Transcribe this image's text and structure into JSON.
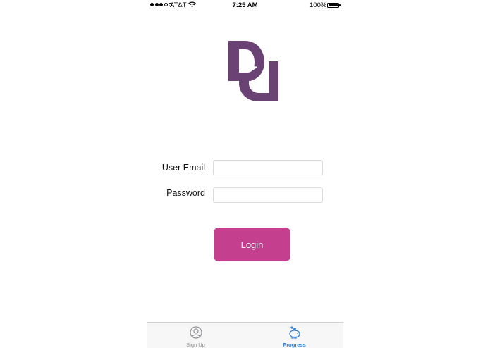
{
  "status_bar": {
    "carrier": "AT&T",
    "time": "7:25 AM",
    "battery": "100%",
    "signal_bars_filled": 3,
    "signal_bars_total": 5
  },
  "logo": {
    "color": "#6b4274",
    "icon": "brand-logo-d-leaf"
  },
  "form": {
    "email_label": "User Email",
    "email_value": "",
    "email_placeholder": "",
    "password_label": "Password",
    "password_value": "",
    "password_placeholder": ""
  },
  "login_button": {
    "label": "Login",
    "color": "#c53f8f"
  },
  "tab_bar": {
    "tabs": [
      {
        "label": "Sign Up",
        "icon": "user-circle-icon",
        "active": false
      },
      {
        "label": "Progress",
        "icon": "piggy-bank-icon",
        "active": true
      }
    ],
    "active_color": "#2e7fd6",
    "inactive_color": "#8e8e93"
  }
}
